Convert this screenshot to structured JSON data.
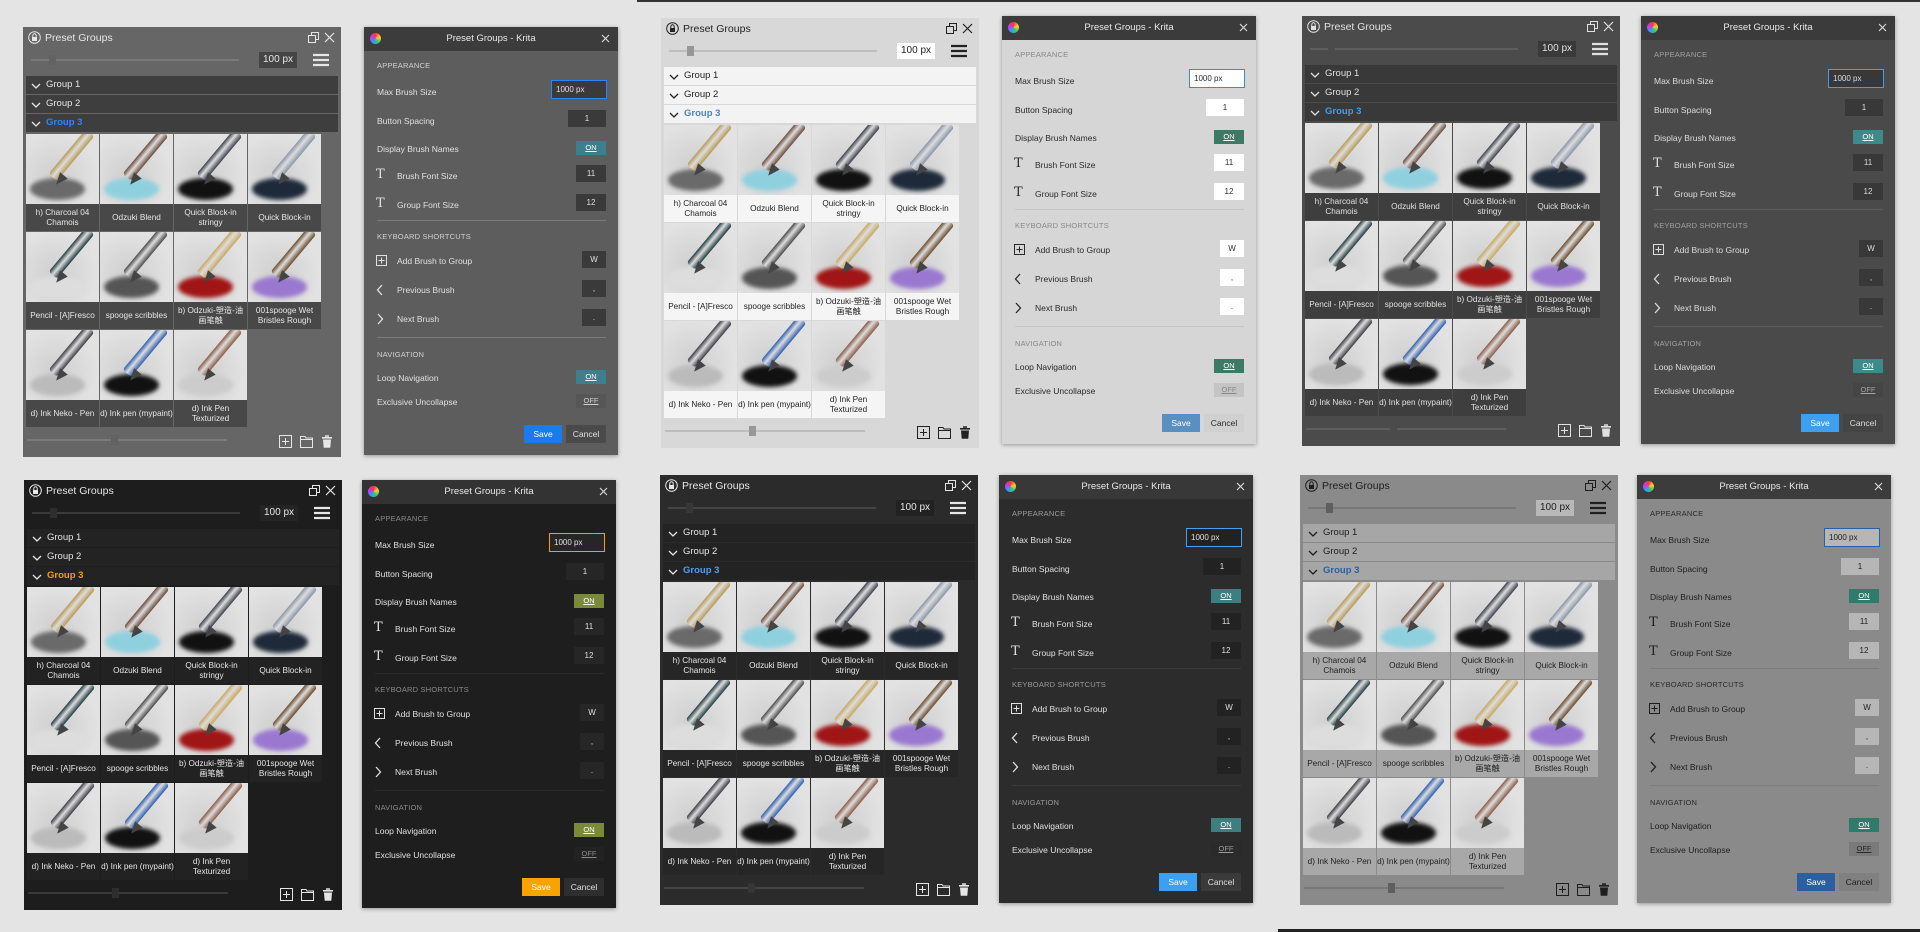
{
  "docker": {
    "title": "Preset Groups",
    "size_value": "100 px",
    "groups": [
      "Group 1",
      "Group 2",
      "Group 3"
    ]
  },
  "brushes": [
    {
      "name": "h) Charcoal 04 Chamois",
      "pen": "#b89a55",
      "stroke": "#6a6a6a"
    },
    {
      "name": "Odzuki Blend",
      "pen": "#6a4a3a",
      "stroke": "#8fd0df"
    },
    {
      "name": "Quick Block-in stringy",
      "pen": "#3a3f4a",
      "stroke": "#111111"
    },
    {
      "name": "Quick Block-in",
      "pen": "#8a95a8",
      "stroke": "#1e2a3a"
    },
    {
      "name": "Pencil - [A]Fresco",
      "pen": "#1f3a40",
      "stroke": "#dddddd"
    },
    {
      "name": "spooge scribbles",
      "pen": "#4a4a4a",
      "stroke": "#555555"
    },
    {
      "name": "b) Odzuki-塑造-油画笔触",
      "pen": "#c9a860",
      "stroke": "#a01515"
    },
    {
      "name": "001spooge Wet Bristles Rough",
      "pen": "#6a4a2a",
      "stroke": "#9a78d0"
    },
    {
      "name": "d) Ink Neko - Pen",
      "pen": "#3a3a44",
      "stroke": "#bbbbbb"
    },
    {
      "name": "d) Ink pen (mypaint)",
      "pen": "#2f5fb0",
      "stroke": "#111111"
    },
    {
      "name": "d) Ink Pen Texturized",
      "pen": "#8a5a45",
      "stroke": "#cccccc"
    }
  ],
  "dialog": {
    "title": "Preset Groups - Krita",
    "appearance_header": "APPEARANCE",
    "max_brush_size_label": "Max Brush Size",
    "max_brush_size_value": "1000 px",
    "button_spacing_label": "Button Spacing",
    "button_spacing_value": "1",
    "display_names_label": "Display Brush Names",
    "display_names_value": "ON",
    "brush_font_label": "Brush Font Size",
    "brush_font_value": "11",
    "group_font_label": "Group Font Size",
    "group_font_value": "12",
    "shortcuts_header": "KEYBOARD SHORTCUTS",
    "add_brush_label": "Add Brush to Group",
    "add_brush_key": "W",
    "prev_brush_label": "Previous Brush",
    "prev_brush_key": ",",
    "next_brush_label": "Next Brush",
    "next_brush_key": ".",
    "navigation_header": "NAVIGATION",
    "loop_label": "Loop Navigation",
    "loop_value": "ON",
    "exclusive_label": "Exclusive Uncollapse",
    "exclusive_value": "OFF",
    "save_label": "Save",
    "cancel_label": "Cancel"
  },
  "themes": [
    {
      "name": "gray",
      "dockBg": "#666666",
      "text": "#e6e6e6",
      "grpBg": "#3e3e3e",
      "capBg": "#484848",
      "accent": "#2a86ff",
      "field": "#454545",
      "track": "#7a7a7a",
      "dlgBg": "#5d5d5d",
      "dlgTitle": "#3c3c3c",
      "dlgText": "#e0e0e0",
      "sec": "#d0d0d0",
      "input": "#3a3a3a",
      "on": "#3e7f8f",
      "off": "#565656",
      "save": "#1a7af0",
      "saveText": "#ffffff",
      "cancel": "#4a4a4a",
      "div": "#7a7a7a"
    },
    {
      "name": "light",
      "dockBg": "#d8d8d8",
      "text": "#222222",
      "grpBg": "#f3f3f3",
      "capBg": "#f5f5f5",
      "accent": "#4a86c0",
      "field": "#ffffff",
      "track": "#bdbdbd",
      "dlgBg": "#d6d6d6",
      "dlgTitle": "#3b3b3b",
      "dlgText": "#2a2a2a",
      "sec": "#888888",
      "input": "#ffffff",
      "on": "#3d7a66",
      "off": "#c4c4c4",
      "save": "#5a8fc2",
      "saveText": "#ffffff",
      "cancel": "#d0d0d0",
      "div": "#c6c6c6"
    },
    {
      "name": "dark-gray",
      "dockBg": "#4b4b4b",
      "text": "#e0e0e0",
      "grpBg": "#393939",
      "capBg": "#3e3e3e",
      "accent": "#3d9ff0",
      "field": "#3a3a3a",
      "track": "#5e5e5e",
      "dlgBg": "#4a4a4a",
      "dlgTitle": "#3b3b3b",
      "dlgText": "#dddddd",
      "sec": "#a0a0a0",
      "input": "#383838",
      "on": "#3d8a8a",
      "off": "#454545",
      "save": "#3d9ff0",
      "saveText": "#ffffff",
      "cancel": "#444444",
      "div": "#5a5a5a"
    },
    {
      "name": "black-orange",
      "dockBg": "#1d1d1d",
      "text": "#e6e6e6",
      "grpBg": "#232323",
      "capBg": "#222222",
      "accent": "#f5a000",
      "field": "#242424",
      "track": "#3a3a3a",
      "dlgBg": "#1e1e1e",
      "dlgTitle": "#333333",
      "dlgText": "#e0e0e0",
      "sec": "#8a8a8a",
      "input": "#262626",
      "on": "#7a8a3a",
      "off": "#222222",
      "save": "#f7a400",
      "saveText": "#ffffff",
      "cancel": "#2e2e2e",
      "div": "#2a2a2a"
    },
    {
      "name": "charcoal-blue",
      "dockBg": "#2b2b2b",
      "text": "#e6e6e6",
      "grpBg": "#232323",
      "capBg": "#262626",
      "accent": "#4aa0f0",
      "field": "#222222",
      "track": "#444444",
      "dlgBg": "#2c2c2c",
      "dlgTitle": "#383838",
      "dlgText": "#e0e0e0",
      "sec": "#9a9a9a",
      "input": "#222222",
      "on": "#3d7f80",
      "off": "#2a2a2a",
      "save": "#3d9ff0",
      "saveText": "#ffffff",
      "cancel": "#3a3a3a",
      "div": "#3a3a3a"
    },
    {
      "name": "mid-gray",
      "dockBg": "#8a8a8a",
      "text": "#1e1e1e",
      "grpBg": "#a6a6a6",
      "capBg": "#a8a8a8",
      "accent": "#2a5fa6",
      "field": "#b8b8b8",
      "track": "#777777",
      "dlgBg": "#8a8a8a",
      "dlgTitle": "#3c3c3c",
      "dlgText": "#1e1e1e",
      "sec": "#2a2a2a",
      "input": "#b6b6b6",
      "on": "#2f7a6a",
      "off": "#7a7a7a",
      "save": "#2a5fa0",
      "saveText": "#ffffff",
      "cancel": "#808080",
      "div": "#7e7e7e"
    }
  ]
}
